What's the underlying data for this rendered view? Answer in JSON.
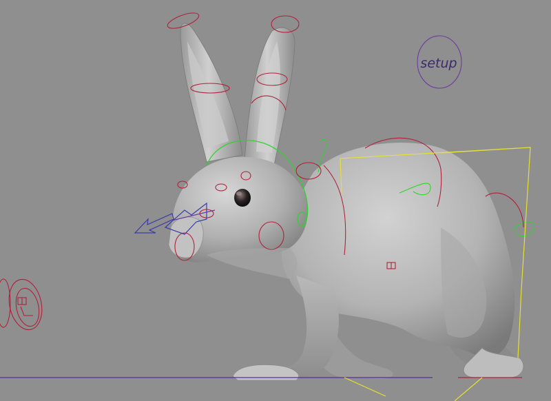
{
  "viewport": {
    "background_color": "#8f8f8f"
  },
  "rig": {
    "setup_label": "setup",
    "colors": {
      "red_control": "#b0203a",
      "green_control": "#2fd22f",
      "yellow_control": "#e6e030",
      "blue_control": "#3a3aa8",
      "purple_control": "#6a3aa0",
      "ground_line": "#5a2aa0"
    }
  },
  "model": {
    "name_icon": "rabbit-mesh-icon"
  }
}
